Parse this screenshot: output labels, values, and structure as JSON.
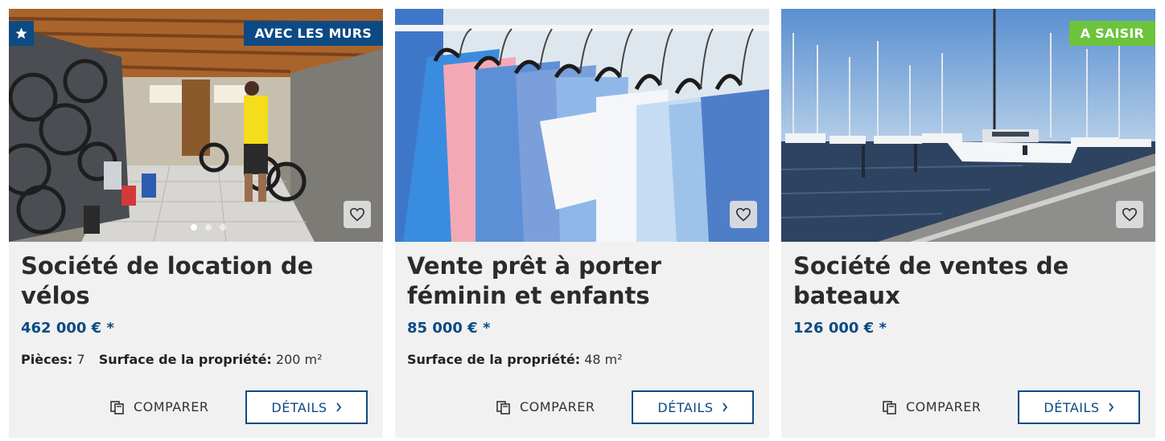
{
  "listings": [
    {
      "badge": "AVEC LES MURS",
      "featured_icon": "star-icon",
      "title": "Société de location de vélos",
      "price": "462 000 € *",
      "specs": [
        {
          "label": "Pièces:",
          "value": "7"
        },
        {
          "label": "Surface de la propriété:",
          "value": "200 m²"
        }
      ],
      "compare_label": "COMPARER",
      "details_label": "DÉTAILS",
      "image": "bike-rental-garage"
    },
    {
      "title": "Vente prêt à porter féminin et enfants",
      "price": "85 000 € *",
      "specs": [
        {
          "label": "Surface de la propriété:",
          "value": "48 m²"
        }
      ],
      "compare_label": "COMPARER",
      "details_label": "DÉTAILS",
      "image": "clothes-rack"
    },
    {
      "badge": "A SAISIR",
      "title": "Société de ventes de bateaux",
      "price": "126 000 € *",
      "specs": [],
      "compare_label": "COMPARER",
      "details_label": "DÉTAILS",
      "image": "marina-sailboats"
    }
  ],
  "colors": {
    "brand_blue": "#0d4a84",
    "saisir_green": "#6bc43b",
    "card_bg": "#f1f1f1"
  }
}
